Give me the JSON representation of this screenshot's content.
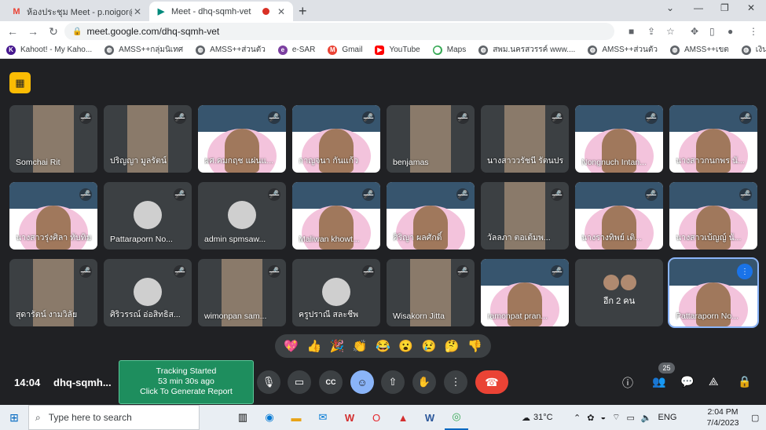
{
  "browser": {
    "tabs": [
      {
        "title": "ห้องประชุม Meet - p.noigor@gmail",
        "favicon": "gmail-icon",
        "active": false
      },
      {
        "title": "Meet - dhq-sqmh-vet",
        "favicon": "meet-icon",
        "active": true,
        "recording": true
      }
    ],
    "url": "meet.google.com/dhq-sqmh-vet",
    "bookmarks": [
      {
        "label": "Kahoot! - My Kaho...",
        "icon": "kahoot-icon"
      },
      {
        "label": "AMSS++กลุ่มนิเทศ",
        "icon": "globe-icon"
      },
      {
        "label": "AMSS++ส่วนตัว",
        "icon": "globe-icon"
      },
      {
        "label": "e-SAR",
        "icon": "esar-icon"
      },
      {
        "label": "Gmail",
        "icon": "gmail-icon"
      },
      {
        "label": "YouTube",
        "icon": "youtube-icon"
      },
      {
        "label": "Maps",
        "icon": "maps-icon"
      },
      {
        "label": "สพม.นครสวรรค์ www....",
        "icon": "globe-icon"
      },
      {
        "label": "AMSS++ส่วนตัว",
        "icon": "globe-icon"
      },
      {
        "label": "AMSS++เขต",
        "icon": "globe-icon"
      },
      {
        "label": "เงินเดือน",
        "icon": "globe-icon"
      }
    ]
  },
  "participants": [
    {
      "name": "Somchai Rit",
      "kind": "photo",
      "muted": true
    },
    {
      "name": "ปริญญา มูลรัตน์",
      "kind": "photo",
      "muted": true
    },
    {
      "name": "ผศ.คมกฤช แผ่นแ...",
      "kind": "slide",
      "muted": true
    },
    {
      "name": "กาญจนา กันแก้ว",
      "kind": "slide",
      "muted": true
    },
    {
      "name": "benjamas",
      "kind": "photo",
      "muted": true
    },
    {
      "name": "นางสาววรัชนี รัตนปร...",
      "kind": "photo",
      "muted": true
    },
    {
      "name": "Nongnuch Intan...",
      "kind": "slide",
      "muted": true
    },
    {
      "name": "นางสาวกนกพร นั...",
      "kind": "slide",
      "muted": true
    },
    {
      "name": "นางสาวรุ่งศิลา ทับทิม",
      "kind": "slide",
      "muted": true
    },
    {
      "name": "Pattaraporn No...",
      "kind": "avatar",
      "muted": true
    },
    {
      "name": "admin spmsaw...",
      "kind": "avatar",
      "muted": true
    },
    {
      "name": "Maliwan khowt...",
      "kind": "slide",
      "muted": true
    },
    {
      "name": "ศิริญา ผลศักดิ์",
      "kind": "slide",
      "muted": true
    },
    {
      "name": "วัลลภา ตอเต้มพ...",
      "kind": "photo",
      "muted": true
    },
    {
      "name": "นางรางทิพย์ เติ...",
      "kind": "slide",
      "muted": true
    },
    {
      "name": "นางสาวเบ้ญญ์ นั...",
      "kind": "slide",
      "muted": true
    },
    {
      "name": "สุดารัตน์ งามวิลัย",
      "kind": "photo",
      "muted": true
    },
    {
      "name": "ศิริวรรณ์ อ่อสิทธิส...",
      "kind": "avatar",
      "muted": true
    },
    {
      "name": "wimonpan sam...",
      "kind": "photo",
      "muted": true
    },
    {
      "name": "ครูปราณี สละชีพ",
      "kind": "avatar",
      "muted": true
    },
    {
      "name": "Wisakorn Jitta",
      "kind": "photo",
      "muted": true
    },
    {
      "name": "ramonpat pran...",
      "kind": "slide",
      "muted": true
    },
    {
      "name": "อีก 2 คน",
      "kind": "others",
      "muted": false
    },
    {
      "name": "Pattaraporn No...",
      "kind": "slide",
      "muted": false,
      "speaking": true
    }
  ],
  "reactions": [
    "💖",
    "👍",
    "🎉",
    "👏",
    "😂",
    "😮",
    "😢",
    "🤔",
    "👎"
  ],
  "controls": {
    "time": "14:04",
    "meeting_code": "dhq-sqmh...",
    "tracker": {
      "line1": "Tracking Started",
      "line2": "53 min 30s ago",
      "line3": "Click To Generate Report"
    },
    "participant_count": "25"
  },
  "taskbar": {
    "search_placeholder": "Type here to search",
    "weather": "31°C",
    "language": "ENG",
    "time": "2:04 PM",
    "date": "7/4/2023"
  },
  "colors": {
    "meet_bg": "#202124",
    "tile_bg": "#3c4043",
    "leave_red": "#ea4335",
    "tracker_green": "#1e8e5e",
    "speaking_blue": "#1a73e8"
  }
}
